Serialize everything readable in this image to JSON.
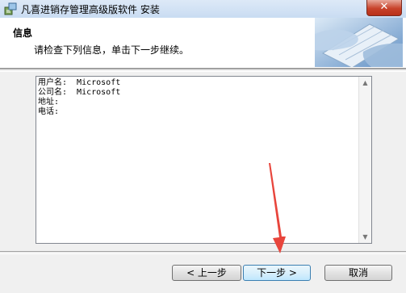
{
  "window": {
    "title": "凡喜进销存管理高级版软件 安装",
    "close_label": "✕"
  },
  "header": {
    "title": "信息",
    "subtitle": "请检查下列信息，单击下一步继续。"
  },
  "info": {
    "text": "用户名:  Microsoft\n公司名:  Microsoft\n地址:\n电话:"
  },
  "buttons": {
    "back": "< 上一步",
    "next": "下一步 >",
    "cancel": "取消"
  },
  "colors": {
    "annotation_arrow": "#e8453c"
  }
}
